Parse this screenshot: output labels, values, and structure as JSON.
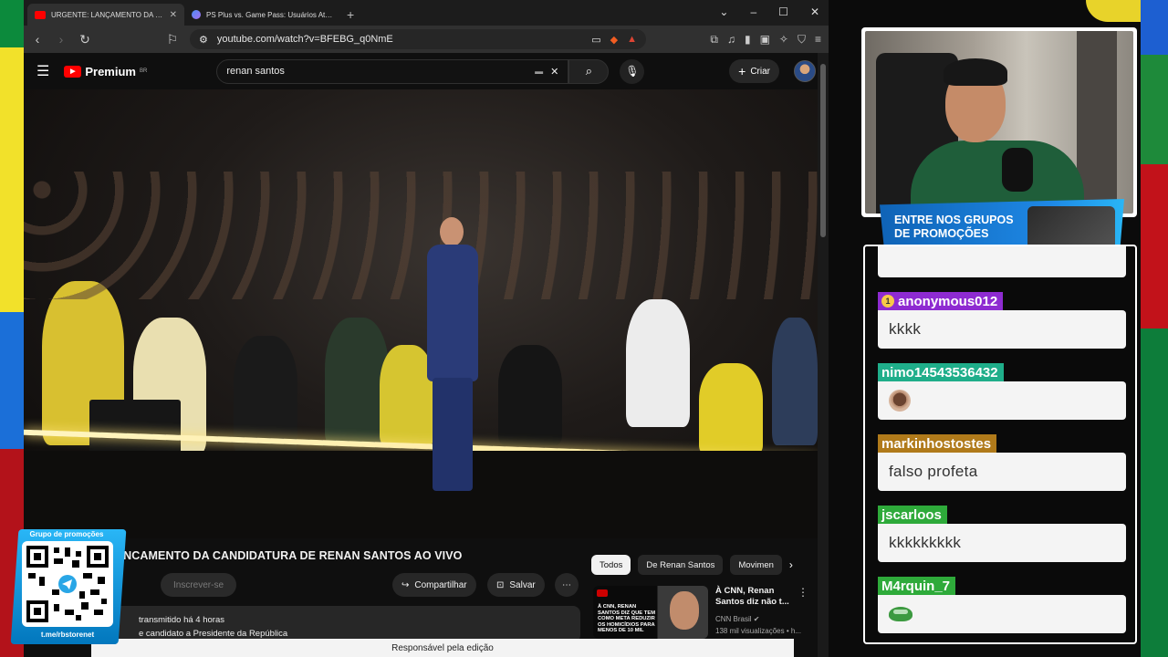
{
  "browser": {
    "tabs": [
      {
        "title": "URGENTE: LANÇAMENTO DA CANDIDATURA",
        "active": true
      },
      {
        "title": "PS Plus vs. Game Pass: Usuários Ativos - Gem",
        "active": false
      }
    ],
    "new_tab_symbol": "+",
    "window_controls": [
      "⌄",
      "–",
      "☐",
      "✕"
    ],
    "url": "youtube.com/watch?v=BFEBG_q0NmE"
  },
  "youtube": {
    "logo_text": "Premium",
    "logo_region": "BR",
    "search_value": "renan santos",
    "create_label": "Criar",
    "video_title": "ANCAMENTO DA CANDIDATURA DE RENAN SANTOS AO VIVO",
    "subscribe_label": "Inscrever-se",
    "share_label": "Compartilhar",
    "save_label": "Salvar",
    "desc_line1": "transmitido há 4 horas",
    "desc_line2": "e candidato a Presidente da República",
    "chips": [
      "Todos",
      "De Renan Santos",
      "Movimen"
    ],
    "recommended": {
      "title": "À CNN, Renan Santos diz não t...",
      "channel": "CNN Brasil",
      "views": "138 mil visualizações • h...",
      "thumb_caption": "À CNN, RENAN SANTOS DIZ QUE TEM COMO META REDUZIR OS HOMICÍDIOS PARA MENOS DE 10 MIL"
    },
    "bottom_caption": "Responsável pela edição"
  },
  "overlay": {
    "qr_label": "Grupo de promoções",
    "qr_url": "t.me/rbstorenet",
    "promo_text": "ENTRE NOS GRUPOS DE PROMOÇÕES"
  },
  "chat": {
    "messages": [
      {
        "user": "anonymous012",
        "user_color": "#8e2bd1",
        "badge": "1",
        "text": "kkkk",
        "emote": ""
      },
      {
        "user": "nimo14543536432",
        "user_color": "#1fae8a",
        "badge": "",
        "text": "",
        "emote": "face"
      },
      {
        "user": "markinhostostes",
        "user_color": "#b07a1a",
        "badge": "",
        "text": "falso profeta",
        "emote": ""
      },
      {
        "user": "jscarloos",
        "user_color": "#2eaa3a",
        "badge": "",
        "text": "kkkkkkkkk",
        "emote": ""
      },
      {
        "user": "M4rquin_7",
        "user_color": "#2eaa3a",
        "badge": "",
        "text": "",
        "emote": "frog"
      }
    ]
  }
}
